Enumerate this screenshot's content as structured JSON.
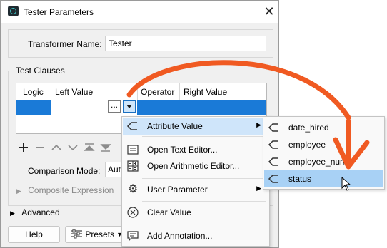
{
  "window": {
    "title": "Tester Parameters",
    "close_glyph": "✕"
  },
  "form": {
    "transformer_name_label": "Transformer Name:",
    "transformer_name_value": "Tester",
    "test_clauses_label": "Test Clauses",
    "table_headers": [
      "Logic",
      "Left Value",
      "Operator",
      "Right Value"
    ],
    "ellipsis_label": "...",
    "comparison_mode_label": "Comparison Mode:",
    "comparison_mode_value": "Aut",
    "composite_expression_label": "Composite Expression",
    "advanced_label": "Advanced"
  },
  "buttons": {
    "help": "Help",
    "presets": "Presets"
  },
  "context_menu": {
    "items": [
      {
        "label": "Attribute Value",
        "icon": "attribute-icon",
        "submenu": true
      },
      {
        "label": "Open Text Editor...",
        "icon": "text-editor-icon",
        "submenu": false
      },
      {
        "label": "Open Arithmetic Editor...",
        "icon": "calculator-icon",
        "submenu": false
      },
      {
        "label": "User Parameter",
        "icon": "gear-icon",
        "submenu": true
      },
      {
        "label": "Clear Value",
        "icon": "clear-icon",
        "submenu": false
      },
      {
        "label": "Add Annotation...",
        "icon": "annotation-icon",
        "submenu": false
      }
    ]
  },
  "attribute_submenu": {
    "items": [
      "date_hired",
      "employee",
      "employee_num",
      "status"
    ],
    "highlighted": "status"
  },
  "colors": {
    "selection_blue": "#1a7ad7",
    "annotation_arrow": "#f05a22",
    "menu_highlight": "#cfe5fa",
    "submenu_highlight": "#a8d1f5"
  }
}
